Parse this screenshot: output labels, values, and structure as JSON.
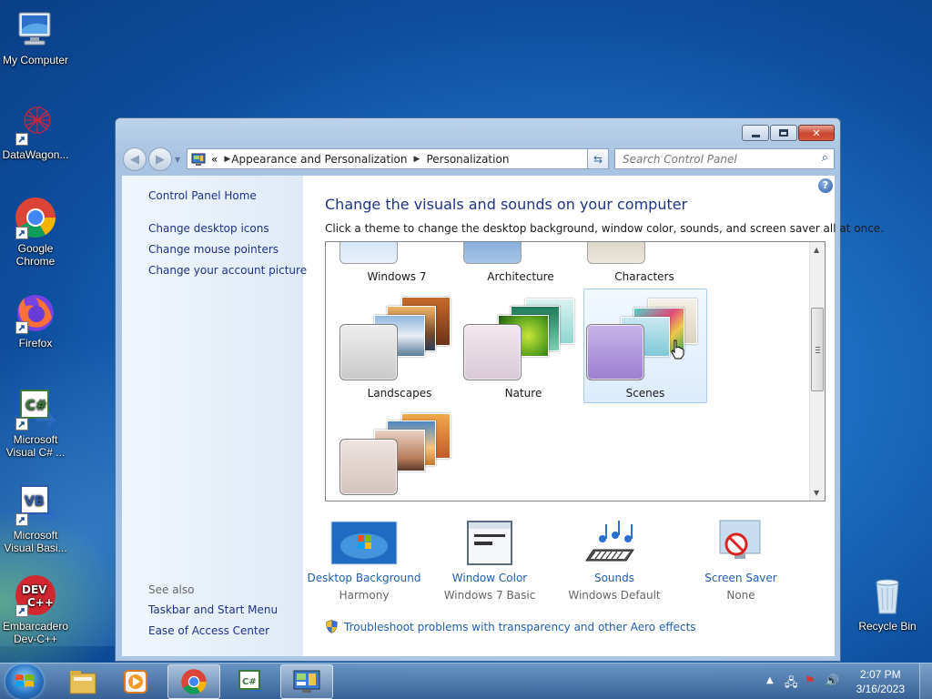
{
  "desktop": {
    "icons": [
      {
        "label": "My Computer"
      },
      {
        "label": "DataWagon..."
      },
      {
        "label": "Google Chrome"
      },
      {
        "label": "Firefox"
      },
      {
        "label": "Microsoft Visual C# ..."
      },
      {
        "label": "Microsoft Visual Basi..."
      },
      {
        "label": "Embarcadero Dev-C++"
      },
      {
        "label": "Recycle Bin"
      }
    ]
  },
  "window": {
    "address": {
      "overflow": "«",
      "crumbs": [
        "Appearance and Personalization",
        "Personalization"
      ]
    },
    "search_placeholder": "Search Control Panel",
    "sidebar": {
      "links": [
        "Control Panel Home",
        "Change desktop icons",
        "Change mouse pointers",
        "Change your account picture"
      ],
      "see_also": "See also",
      "see_also_links": [
        "Taskbar and Start Menu",
        "Ease of Access Center"
      ]
    },
    "main": {
      "heading": "Change the visuals and sounds on your computer",
      "subheading": "Click a theme to change the desktop background, window color, sounds, and screen saver all at once.",
      "themes_top": [
        "Windows 7",
        "Architecture",
        "Characters"
      ],
      "themes": [
        {
          "label": "Landscapes"
        },
        {
          "label": "Nature"
        },
        {
          "label": "Scenes",
          "selected": true
        },
        {
          "label": ""
        }
      ],
      "bottom": [
        {
          "link": "Desktop Background",
          "value": "Harmony"
        },
        {
          "link": "Window Color",
          "value": "Windows 7 Basic"
        },
        {
          "link": "Sounds",
          "value": "Windows Default"
        },
        {
          "link": "Screen Saver",
          "value": "None"
        }
      ],
      "troubleshoot": "Troubleshoot problems with transparency and other Aero effects"
    }
  },
  "taskbar": {
    "time": "2:07 PM",
    "date": "3/16/2023"
  }
}
